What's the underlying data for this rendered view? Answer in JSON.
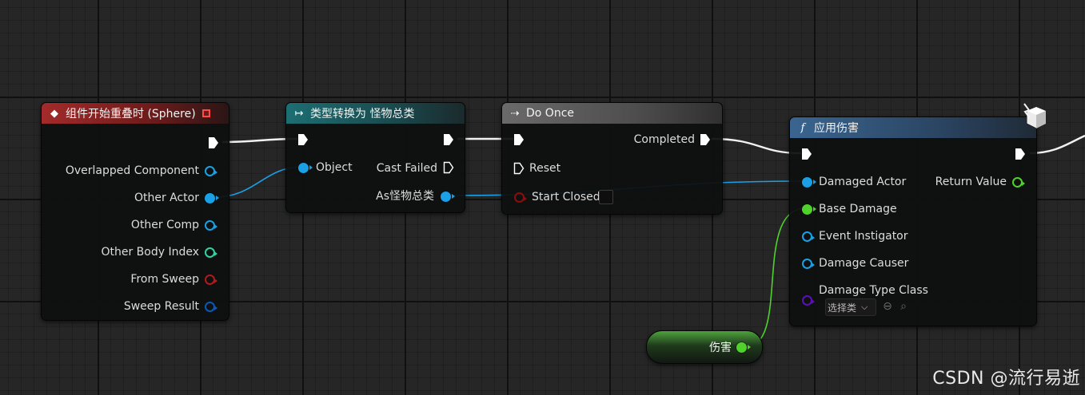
{
  "nodes": {
    "overlap": {
      "title": "组件开始重叠时 (Sphere)",
      "pins": [
        "Overlapped Component",
        "Other Actor",
        "Other Comp",
        "Other Body Index",
        "From Sweep",
        "Sweep Result"
      ]
    },
    "cast": {
      "title": "类型转换为 怪物总类",
      "object_label": "Object",
      "cast_failed_label": "Cast Failed",
      "as_label": "As怪物总类"
    },
    "do_once": {
      "title": "Do Once",
      "completed_label": "Completed",
      "reset_label": "Reset",
      "start_closed_label": "Start Closed"
    },
    "apply_damage": {
      "title": "应用伤害",
      "damaged_actor_label": "Damaged Actor",
      "return_value_label": "Return Value",
      "base_damage_label": "Base Damage",
      "event_instigator_label": "Event Instigator",
      "damage_causer_label": "Damage Causer",
      "damage_type_class_label": "Damage Type Class",
      "class_select_value": "选择类"
    },
    "damage_var": {
      "label": "伤害"
    }
  },
  "watermark": "CSDN @流行易逝",
  "colors": {
    "exec": "#ffffff",
    "object": "#1aa0e6",
    "float": "#4fd32a",
    "struct": "#0a59b8",
    "int": "#2fd3a0",
    "bool": "#8c0d0d",
    "class": "#5a0fb8"
  },
  "icons": {
    "event": "event-diamond-icon",
    "cast": "cast-arrow-icon",
    "flow": "flow-control-icon",
    "function": "function-icon",
    "latent": "latent-function-icon"
  }
}
